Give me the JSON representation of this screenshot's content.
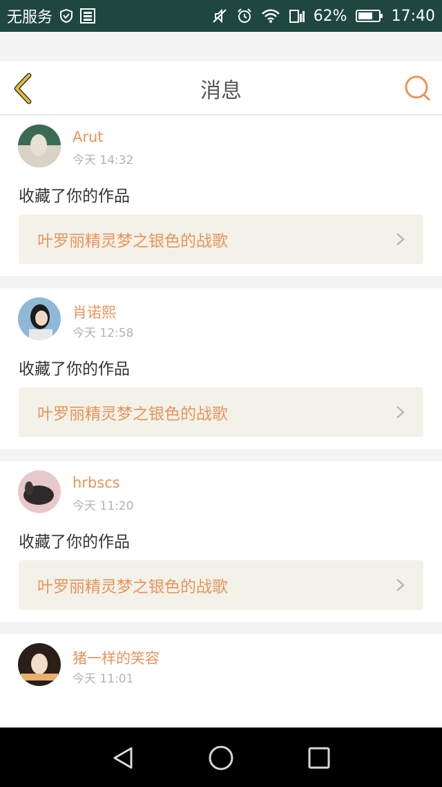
{
  "status_bar": {
    "carrier": "无服务",
    "battery_percent": "62%",
    "time": "17:40"
  },
  "header": {
    "title": "消息"
  },
  "messages": [
    {
      "user": "Arut",
      "time": "今天 14:32",
      "action": "收藏了你的作品",
      "work_title": "叶罗丽精灵梦之银色的战歌",
      "avatar_colors": [
        "#3a6b52",
        "#d9d2c5"
      ]
    },
    {
      "user": "肖诺熙",
      "time": "今天 12:58",
      "action": "收藏了你的作品",
      "work_title": "叶罗丽精灵梦之银色的战歌",
      "avatar_colors": [
        "#8fb8d6",
        "#1c1c1c"
      ]
    },
    {
      "user": "hrbscs",
      "time": "今天 11:20",
      "action": "收藏了你的作品",
      "work_title": "叶罗丽精灵梦之银色的战歌",
      "avatar_colors": [
        "#e8c9c9",
        "#2e2a2a"
      ]
    },
    {
      "user": "猪一样的笑容",
      "time": "今天 11:01",
      "action": "",
      "work_title": "",
      "avatar_colors": [
        "#2a1e18",
        "#e8b06a"
      ]
    }
  ],
  "colors": {
    "accent": "#e8935a",
    "back_icon": "#e0c030",
    "status_bar_bg": "#1e4740",
    "card_link_bg": "#f3f2e9"
  },
  "icons": {
    "back": "chevron-left-icon",
    "search": "search-icon",
    "chevron": "chevron-right-icon",
    "nav": [
      "back-triangle-icon",
      "home-circle-icon",
      "recents-square-icon"
    ]
  }
}
